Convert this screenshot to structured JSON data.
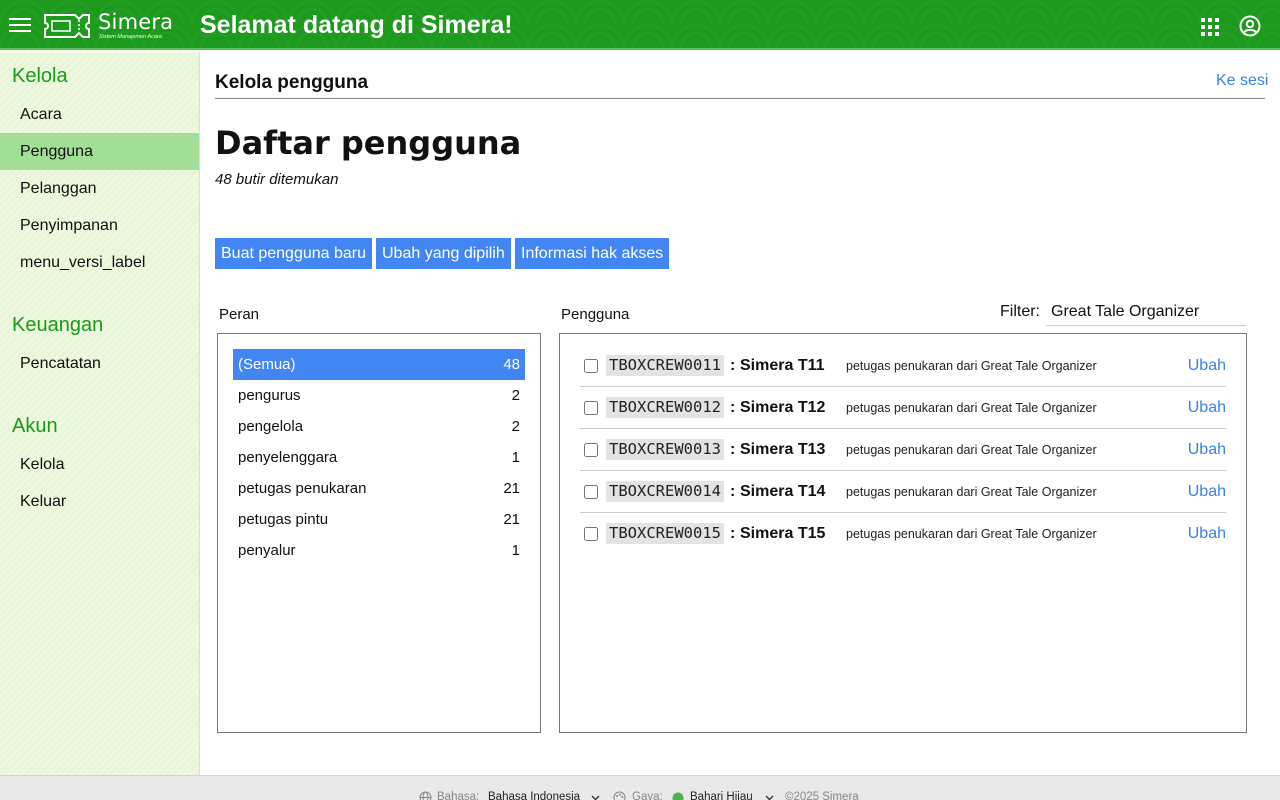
{
  "header": {
    "logo_text": "Simera",
    "logo_tagline": "Sistem Manajemen Acara",
    "title": "Selamat datang di Simera!",
    "icons": [
      "menu-icon",
      "apps-grid-icon",
      "account-circle-icon"
    ]
  },
  "sidebar": {
    "groups": [
      {
        "title": "Kelola",
        "items": [
          "Acara",
          "Pengguna",
          "Pelanggan",
          "Penyimpanan",
          "menu_versi_label"
        ]
      },
      {
        "title": "Keuangan",
        "items": [
          "Pencatatan"
        ]
      },
      {
        "title": "Akun",
        "items": [
          "Kelola",
          "Keluar"
        ]
      }
    ],
    "active_item": "Pengguna"
  },
  "main": {
    "section_title": "Kelola pengguna",
    "to_session_link": "Ke sesi",
    "list_title": "Daftar pengguna",
    "found_text": "48 butir ditemukan",
    "buttons": {
      "create": "Buat pengguna baru",
      "edit_selected": "Ubah yang dipilih",
      "access_info": "Informasi hak akses"
    },
    "roles_label": "Peran",
    "users_label": "Pengguna",
    "filter_label": "Filter:",
    "filter_value": "Great Tale Organizer",
    "roles": [
      {
        "name": "(Semua)",
        "count": "48"
      },
      {
        "name": "pengurus",
        "count": "2"
      },
      {
        "name": "pengelola",
        "count": "2"
      },
      {
        "name": "penyelenggara",
        "count": "1"
      },
      {
        "name": "petugas penukaran",
        "count": "21"
      },
      {
        "name": "petugas pintu",
        "count": "21"
      },
      {
        "name": "penyalur",
        "count": "1"
      }
    ],
    "users": [
      {
        "id": "TBOXCREW0011",
        "name": "Simera T11",
        "desc": "petugas penukaran dari Great Tale Organizer",
        "edit": "Ubah"
      },
      {
        "id": "TBOXCREW0012",
        "name": "Simera T12",
        "desc": "petugas penukaran dari Great Tale Organizer",
        "edit": "Ubah"
      },
      {
        "id": "TBOXCREW0013",
        "name": "Simera T13",
        "desc": "petugas penukaran dari Great Tale Organizer",
        "edit": "Ubah"
      },
      {
        "id": "TBOXCREW0014",
        "name": "Simera T14",
        "desc": "petugas penukaran dari Great Tale Organizer",
        "edit": "Ubah"
      },
      {
        "id": "TBOXCREW0015",
        "name": "Simera T15",
        "desc": "petugas penukaran dari Great Tale Organizer",
        "edit": "Ubah"
      }
    ]
  },
  "footer": {
    "language_label": "Bahasa:",
    "language_value": "Bahasa Indonesia",
    "style_label": "Gaya:",
    "style_value": "Bahari Hijau",
    "copyright": "©2025 Simera"
  },
  "colors": {
    "header_green": "#1d9a1d",
    "sidebar_bg": "#e8f5d6",
    "active_item_bg": "#a2df96",
    "accent_blue": "#4286f4",
    "link_blue": "#3a83e6"
  }
}
